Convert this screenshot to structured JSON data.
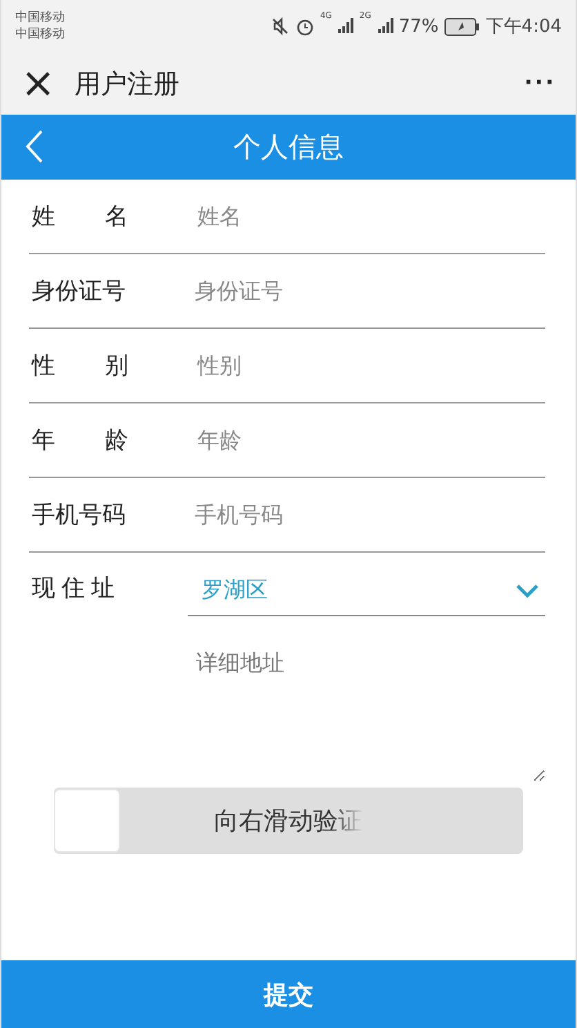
{
  "status_bar": {
    "carriers": [
      "中国移动",
      "中国移动"
    ],
    "networks": [
      "4G",
      "2G"
    ],
    "battery": "77%",
    "time": "下午4:04"
  },
  "title_bar": {
    "close": "×",
    "title": "用户注册",
    "more": "···"
  },
  "header": {
    "title": "个人信息"
  },
  "fields": [
    {
      "label": "姓名",
      "placeholder": "姓名"
    },
    {
      "label": "身份证号",
      "placeholder": "身份证号"
    },
    {
      "label": "性别",
      "placeholder": "性别"
    },
    {
      "label": "年龄",
      "placeholder": "年龄"
    },
    {
      "label": "手机号码",
      "placeholder": "手机号码"
    }
  ],
  "address": {
    "label": "现住址",
    "district": "罗湖区",
    "detail_placeholder": "详细地址"
  },
  "slider": {
    "label": "向右滑动验证",
    "level": 0
  },
  "submit": "提交"
}
